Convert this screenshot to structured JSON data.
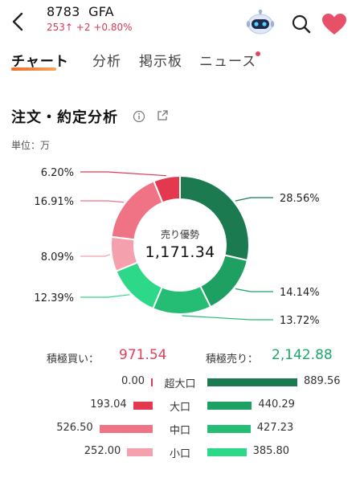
{
  "header": {
    "code": "8783",
    "name": "GFA",
    "price": "253",
    "change_arrow": "↑",
    "change": "+2",
    "change_pct": "+0.80%",
    "icons": [
      "back-icon",
      "robot-icon",
      "search-icon",
      "heart-icon"
    ]
  },
  "tabs": [
    {
      "label": "チャート",
      "active": true
    },
    {
      "label": "分析",
      "active": false
    },
    {
      "label": "掲示板",
      "active": false
    },
    {
      "label": "ニュース",
      "active": false,
      "badge": true
    }
  ],
  "section": {
    "title": "注文・約定分析",
    "unit": "単位：万"
  },
  "chart_data": {
    "type": "pie",
    "donut": true,
    "center_label": "売り優勢",
    "center_value": "1,171.34",
    "slices": [
      {
        "label": "28.56%",
        "value": 28.56,
        "color": "#1b7a4f",
        "side": "sell"
      },
      {
        "label": "14.14%",
        "value": 14.14,
        "color": "#1ea063",
        "side": "sell"
      },
      {
        "label": "13.72%",
        "value": 13.72,
        "color": "#25bd74",
        "side": "sell"
      },
      {
        "label": "12.39%",
        "value": 12.39,
        "color": "#2ed889",
        "side": "sell"
      },
      {
        "label": "8.09%",
        "value": 8.09,
        "color": "#f4a0ad",
        "side": "buy"
      },
      {
        "label": "16.91%",
        "value": 16.91,
        "color": "#ef7285",
        "side": "buy"
      },
      {
        "label": "6.20%",
        "value": 6.2,
        "color": "#e4384f",
        "side": "buy"
      }
    ]
  },
  "totals": {
    "buy_label": "積極買い：",
    "buy_value": "971.54",
    "sell_label": "積極売り：",
    "sell_value": "2,142.88"
  },
  "breakdown": [
    {
      "category": "超大口",
      "buy": "0.00",
      "buy_num": 0.0,
      "buy_color": "#e4384f",
      "sell": "889.56",
      "sell_num": 889.56,
      "sell_color": "#1b7a4f"
    },
    {
      "category": "大口",
      "buy": "193.04",
      "buy_num": 193.04,
      "buy_color": "#e4384f",
      "sell": "440.29",
      "sell_num": 440.29,
      "sell_color": "#1ea063"
    },
    {
      "category": "中口",
      "buy": "526.50",
      "buy_num": 526.5,
      "buy_color": "#ef7285",
      "sell": "427.23",
      "sell_num": 427.23,
      "sell_color": "#25bd74"
    },
    {
      "category": "小口",
      "buy": "252.00",
      "buy_num": 252.0,
      "buy_color": "#f4a0ad",
      "sell": "385.80",
      "sell_num": 385.8,
      "sell_color": "#2ed889"
    }
  ]
}
